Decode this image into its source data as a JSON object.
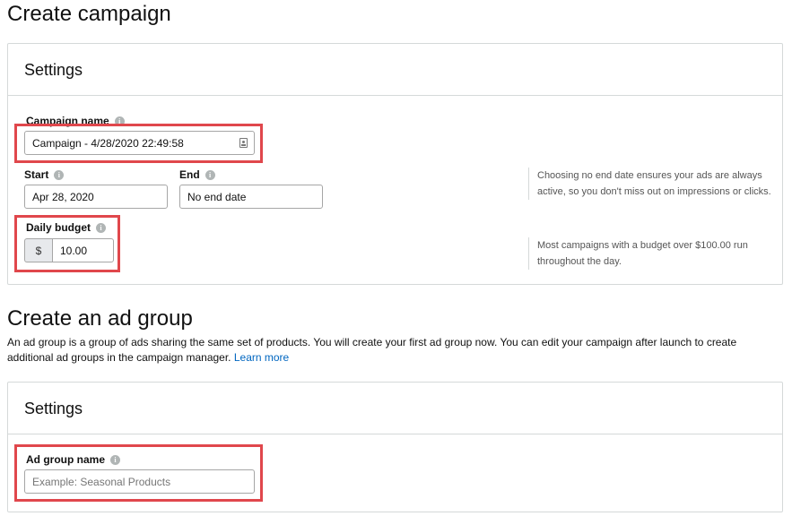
{
  "page": {
    "title": "Create campaign"
  },
  "campaign_settings": {
    "title": "Settings",
    "campaign_name": {
      "label": "Campaign name",
      "value": "Campaign - 4/28/2020 22:49:58"
    },
    "start": {
      "label": "Start",
      "value": "Apr 28, 2020"
    },
    "end": {
      "label": "End",
      "value": "No end date"
    },
    "end_help": "Choosing no end date ensures your ads are always active, so you don't miss out on impressions or clicks.",
    "daily_budget": {
      "label": "Daily budget",
      "currency": "$",
      "value": "10.00"
    },
    "budget_help": "Most campaigns with a budget over $100.00 run throughout the day."
  },
  "ad_group": {
    "title": "Create an ad group",
    "description": "An ad group is a group of ads sharing the same set of products. You will create your first ad group now. You can edit your campaign after launch to create additional ad groups in the campaign manager.",
    "learn_more": "Learn more",
    "settings_title": "Settings",
    "name": {
      "label": "Ad group name",
      "placeholder": "Example: Seasonal Products"
    }
  },
  "icons": {
    "info": "info-icon",
    "id_card": "id-card-icon"
  },
  "colors": {
    "highlight": "#e0474c",
    "link": "#0066c0"
  }
}
